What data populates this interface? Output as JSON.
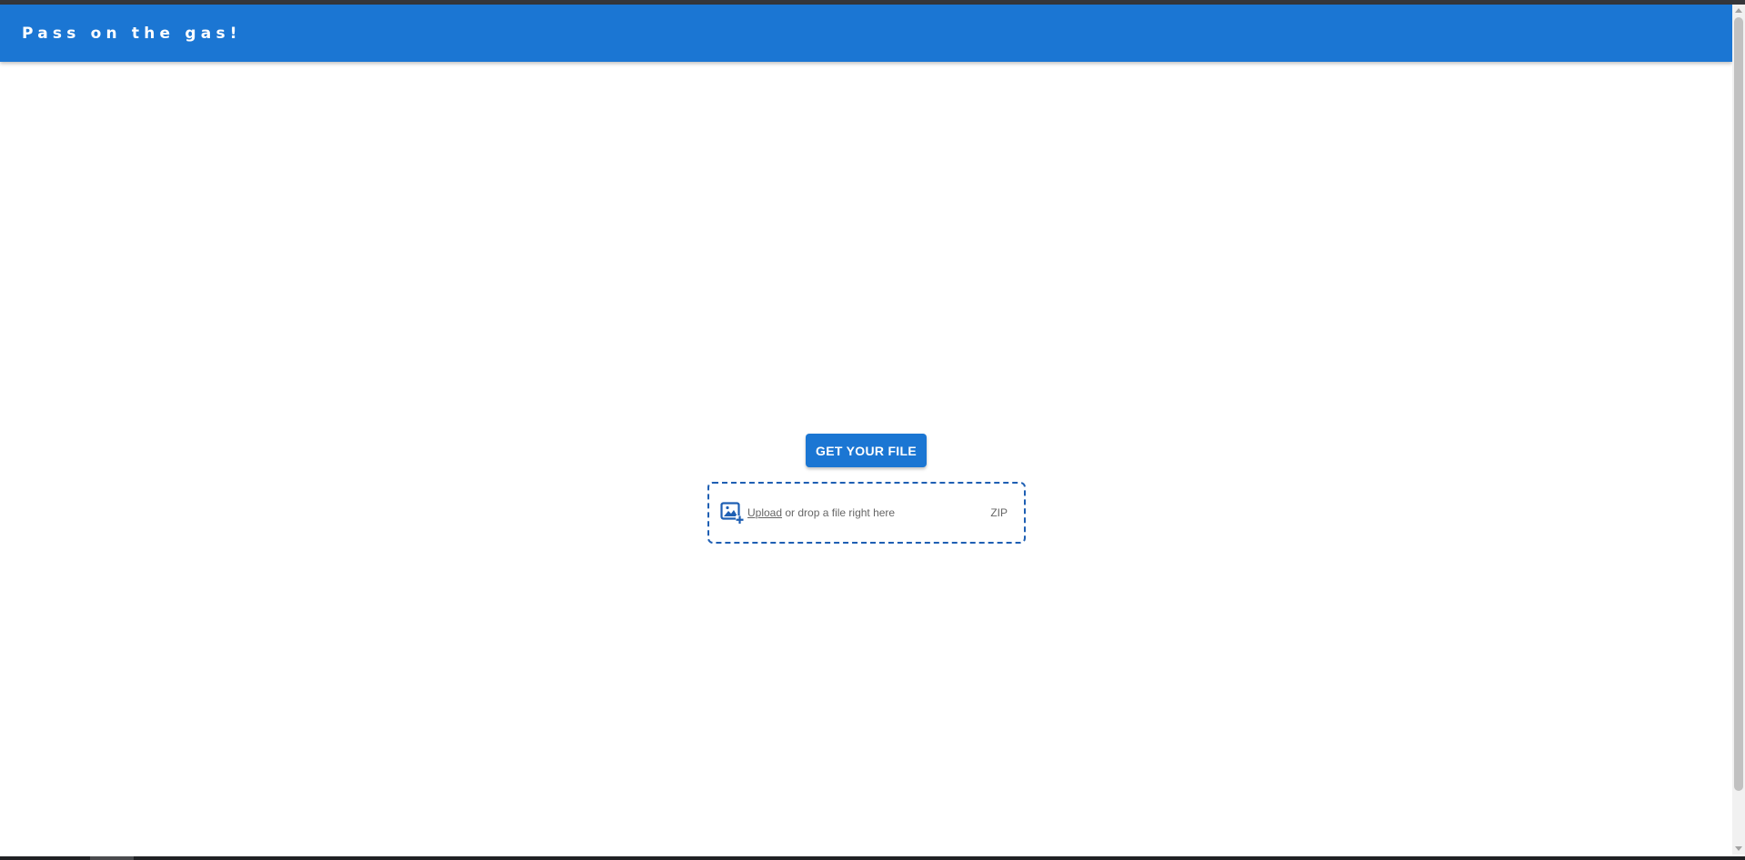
{
  "header": {
    "title": "Pass on the gas!"
  },
  "main": {
    "get_file_button": "GET YOUR FILE",
    "drop_zone": {
      "upload_link": "Upload",
      "drop_text": " or drop a file right here",
      "file_types": "ZIP",
      "icon": "image-add-icon"
    }
  },
  "colors": {
    "app_bar": "#1b76d3",
    "accent": "#1e5fb3"
  }
}
